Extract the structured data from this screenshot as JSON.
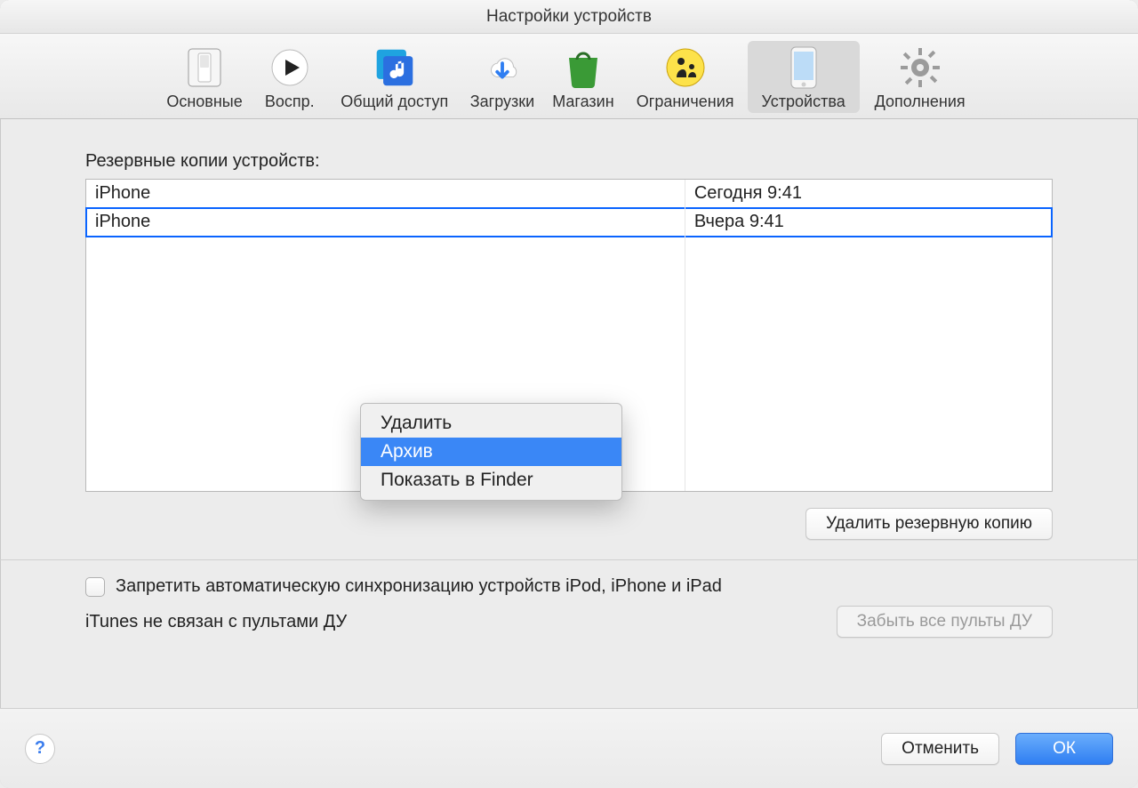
{
  "window": {
    "title": "Настройки устройств"
  },
  "toolbar": {
    "items": [
      {
        "label": "Основные"
      },
      {
        "label": "Воспр."
      },
      {
        "label": "Общий доступ"
      },
      {
        "label": "Загрузки"
      },
      {
        "label": "Магазин"
      },
      {
        "label": "Ограничения"
      },
      {
        "label": "Устройства"
      },
      {
        "label": "Дополнения"
      }
    ],
    "selected_index": 6
  },
  "backups": {
    "section_label": "Резервные копии устройств:",
    "rows": [
      {
        "name": "iPhone",
        "date": "Сегодня 9:41"
      },
      {
        "name": "iPhone",
        "date": "Вчера 9:41"
      }
    ],
    "selected_index": 1,
    "delete_button": "Удалить резервную копию"
  },
  "context_menu": {
    "items": [
      {
        "label": "Удалить"
      },
      {
        "label": "Архив"
      },
      {
        "label": "Показать в Finder"
      }
    ],
    "highlight_index": 1
  },
  "options": {
    "prevent_sync_label": "Запретить автоматическую синхронизацию устройств iPod, iPhone и iPad",
    "remote_status": "iTunes не связан с пультами ДУ",
    "forget_remotes_button": "Забыть все пульты ДУ"
  },
  "footer": {
    "cancel": "Отменить",
    "ok": "ОК"
  }
}
